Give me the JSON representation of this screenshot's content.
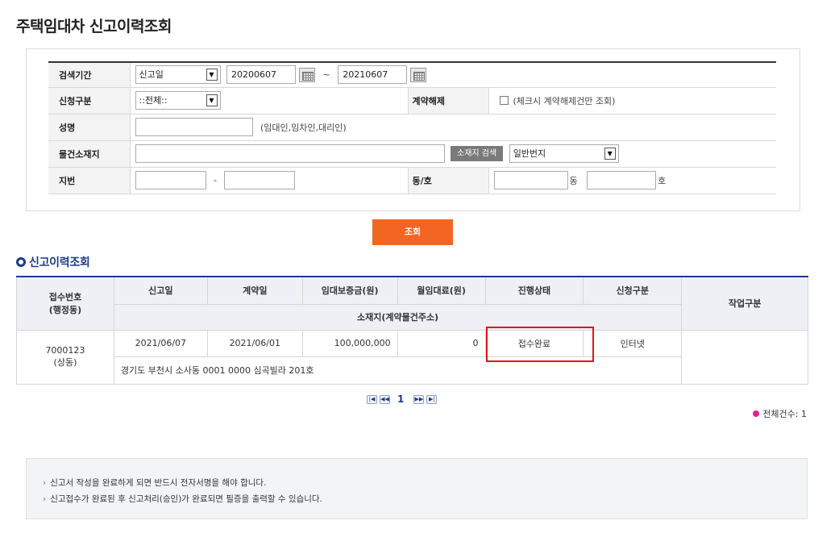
{
  "page": {
    "title": "주택임대차 신고이력조회"
  },
  "search": {
    "period": {
      "label": "검색기간",
      "type_value": "신고일",
      "from": "20200607",
      "sep": "~",
      "to": "20210607"
    },
    "category": {
      "label": "신청구분",
      "value": "::전체::"
    },
    "cancel": {
      "label": "계약해제",
      "hint": "(체크시 계약해제건만 조회)"
    },
    "name": {
      "label": "성명",
      "value": "",
      "hint": "(임대인,임차인,대리인)"
    },
    "location": {
      "label": "물건소재지",
      "value": "",
      "button": "소재지 검색",
      "type_value": "일반번지"
    },
    "lot": {
      "label": "지번",
      "main": "",
      "dash": "-",
      "sub": ""
    },
    "unit": {
      "label": "동/호",
      "dong": "",
      "dong_suffix": "동",
      "ho": "",
      "ho_suffix": "호"
    },
    "submit": "조회"
  },
  "results": {
    "title": "신고이력조회",
    "headers": {
      "receipt_no": "접수번호",
      "receipt_no_sub": "(행정동)",
      "report_date": "신고일",
      "contract_date": "계약일",
      "deposit": "임대보증금(원)",
      "rent": "월임대료(원)",
      "status": "진행상태",
      "apply_type": "신청구분",
      "address": "소재지(계약물건주소)",
      "job": "작업구분"
    },
    "rows": [
      {
        "receipt_no": "7000123",
        "dong": "(상동)",
        "report_date": "2021/06/07",
        "contract_date": "2021/06/01",
        "deposit": "100,000,000",
        "rent": "0",
        "status": "접수완료",
        "apply_type": "인터넷",
        "job": "",
        "address": "경기도 부천시 소사동 0001 0000 심곡빌라 201호"
      }
    ],
    "pager": {
      "current": "1"
    },
    "total": "전체건수: 1",
    "highlight_color": "#e0161b"
  },
  "notice": {
    "lines": [
      "신고서 작성을 완료하게 되면 반드시 전자서명을 해야 합니다.",
      "신고접수가 완료된 후 신고처리(승인)가 완료되면 필증을 출력할 수 있습니다."
    ]
  },
  "colors": {
    "accent": "#f26522",
    "navy": "#1b3a8a"
  }
}
